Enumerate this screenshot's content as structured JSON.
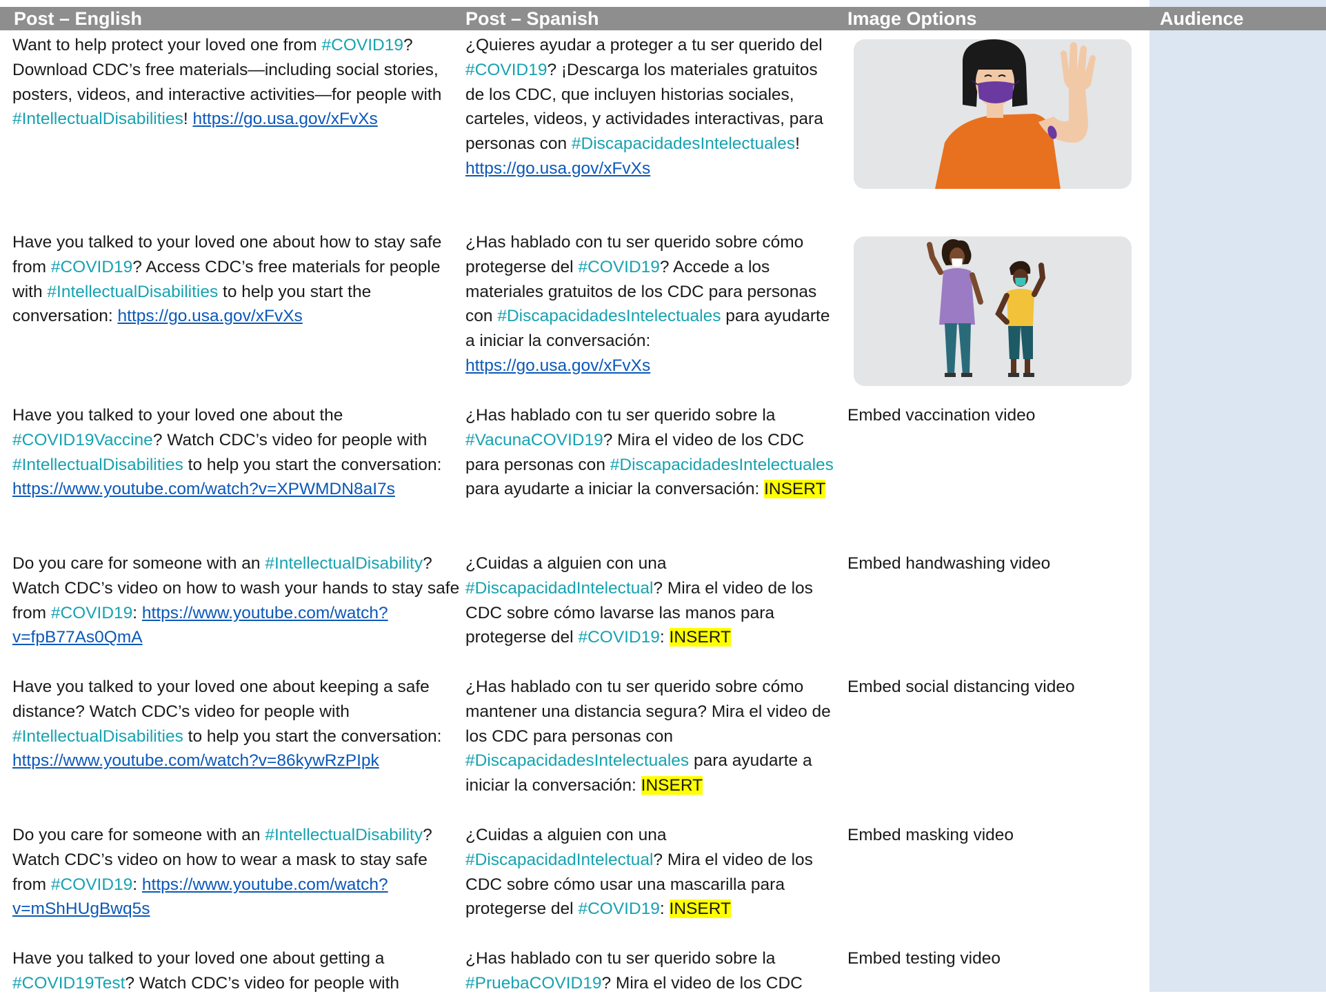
{
  "header": {
    "col_english": "Post – English",
    "col_spanish": "Post – Spanish",
    "col_image": "Image Options",
    "col_audience": "Audience"
  },
  "rows": [
    {
      "en": {
        "t1": "Want to help protect your loved one from ",
        "h1": "#COVID19",
        "t2": "? Download CDC’s free materials—including social stories, posters, videos, and interactive activities—for people with ",
        "h2": "#IntellectualDisabilities",
        "t3": "! ",
        "link": "https://go.usa.gov/xFvXs"
      },
      "es": {
        "t1": "¿Quieres ayudar a proteger a tu ser querido del ",
        "h1": "#COVID19",
        "t2": "? ¡Descarga los materiales gratuitos de los CDC, que incluyen historias sociales, carteles, videos, y actividades interactivas, para personas con ",
        "h2": "#DiscapacidadesIntelectuales",
        "t3": "! ",
        "link": "https://go.usa.gov/xFvXs"
      },
      "image": "woman-waving-with-bandage-illustration"
    },
    {
      "en": {
        "t1": "Have you talked to your loved one about how to stay safe from ",
        "h1": "#COVID19",
        "t2": "? Access CDC’s free materials for people with ",
        "h2": "#IntellectualDisabilities",
        "t3": " to help you start the conversation: ",
        "link": "https://go.usa.gov/xFvXs"
      },
      "es": {
        "t1": "¿Has hablado con tu ser querido sobre cómo protegerse del ",
        "h1": "#COVID19",
        "t2": "? Accede a los materiales gratuitos de los CDC para personas con ",
        "h2": "#DiscapacidadesIntelectuales",
        "t3": " para ayudarte a iniciar la conversación: ",
        "link": "https://go.usa.gov/xFvXs"
      },
      "image": "two-people-waving-illustration"
    },
    {
      "en": {
        "t1": "Have you talked to your loved one about the ",
        "h1": "#COVID19Vaccine",
        "t2": "? Watch CDC’s video for people with ",
        "h2": "#IntellectualDisabilities",
        "t3": " to help you start the conversation: ",
        "link": "https://www.youtube.com/watch?v=XPWMDN8aI7s"
      },
      "es": {
        "t1": "¿Has hablado con tu ser querido sobre la ",
        "h1": "#VacunaCOVID19",
        "t2": "? Mira el video de los CDC para personas con ",
        "h2": "#DiscapacidadesIntelectuales",
        "t3": " para ayudarte a iniciar la conversación: ",
        "insert": "INSERT"
      },
      "option": "Embed vaccination video"
    },
    {
      "en": {
        "t1": "Do you care for someone with an ",
        "h1": "#IntellectualDisability",
        "t2": "? Watch CDC’s video on how to wash your hands to stay safe from ",
        "h2": "#COVID19",
        "t3": ": ",
        "link": "https://www.youtube.com/watch?v=fpB77As0QmA"
      },
      "es": {
        "t1": "¿Cuidas a alguien con una ",
        "h1": "#DiscapacidadIntelectual",
        "t2": "? Mira el video de los CDC sobre cómo lavarse las manos para protegerse del ",
        "h2": "#COVID19",
        "t3": ": ",
        "insert": "INSERT"
      },
      "option": "Embed handwashing video"
    },
    {
      "en": {
        "t1": "Have you talked to your loved one about keeping a safe distance? Watch CDC’s video for people with ",
        "h1": "#IntellectualDisabilities",
        "t2": " to help you start the conversation: ",
        "link": "https://www.youtube.com/watch?v=86kywRzPIpk"
      },
      "es": {
        "t1": "¿Has hablado con tu ser querido sobre cómo mantener una distancia segura? Mira el video de los CDC para personas con ",
        "h1": "#DiscapacidadesIntelectuales",
        "t2": " para ayudarte a iniciar la conversación: ",
        "insert": "INSERT"
      },
      "option": "Embed social distancing video"
    },
    {
      "en": {
        "t1": "Do you care for someone with an ",
        "h1": "#IntellectualDisability",
        "t2": "? Watch CDC’s video on how to wear a mask to stay safe from ",
        "h2": "#COVID19",
        "t3": ": ",
        "link": "https://www.youtube.com/watch?v=mShHUgBwq5s"
      },
      "es": {
        "t1": "¿Cuidas a alguien con una ",
        "h1": "#DiscapacidadIntelectual",
        "t2": "? Mira el video de los CDC sobre cómo usar una mascarilla para protegerse del ",
        "h2": "#COVID19",
        "t3": ": ",
        "insert": "INSERT"
      },
      "option": "Embed masking video"
    },
    {
      "en": {
        "t1": "Have you talked to your loved one about getting a ",
        "h1": "#COVID19Test",
        "t2": "? Watch CDC’s video for people with"
      },
      "es": {
        "t1": "¿Has hablado con tu ser querido sobre la ",
        "h1": "#PruebaCOVID19",
        "t2": "? Mira el video de los CDC"
      },
      "option": "Embed testing video"
    }
  ],
  "colors": {
    "header_bg": "#8e8e8e",
    "audience_bg": "#dce6f2",
    "hashtag": "#17a2b0",
    "link": "#0b58b8",
    "insert_highlight": "#ffff00"
  }
}
